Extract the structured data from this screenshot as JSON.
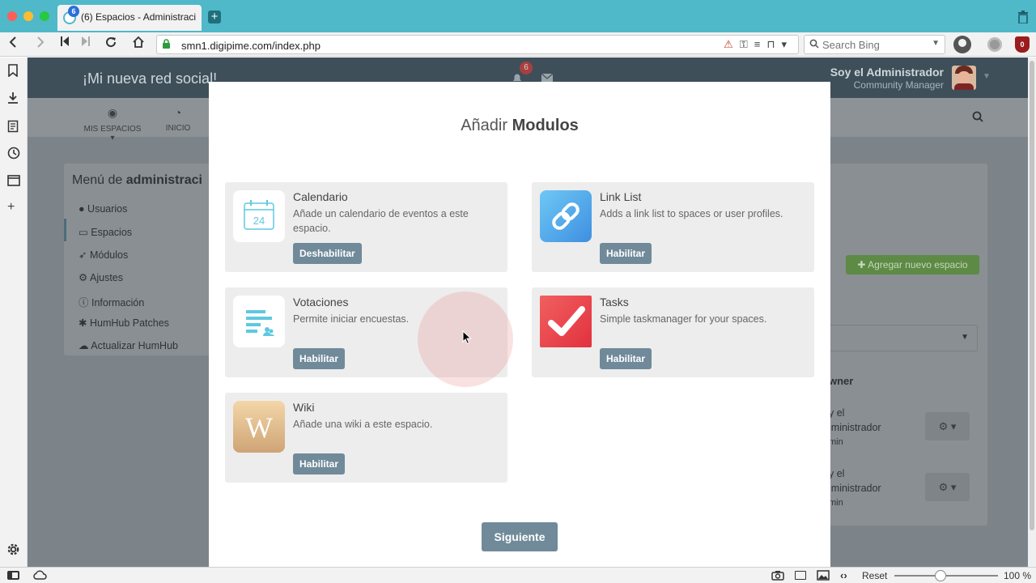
{
  "browser": {
    "tab_title": "(6) Espacios - Administraci",
    "tab_badge": "6",
    "url": "smn1.digipime.com/index.php",
    "search_placeholder": "Search Bing",
    "zoom_reset": "Reset",
    "zoom_level": "100 %",
    "zoom_fraction": 0.5
  },
  "site": {
    "network_name": "¡Mi nueva red social!",
    "notification_count": "6",
    "user_name": "Soy el Administrador",
    "user_role": "Community Manager"
  },
  "subnav": {
    "my_spaces": "MIS ESPACIOS",
    "home": "INICIO"
  },
  "admin_menu": {
    "title_prefix": "Menú de ",
    "title_bold": "administraci",
    "items": [
      {
        "label": "Usuarios",
        "icon": "user-icon"
      },
      {
        "label": "Espacios",
        "icon": "inbox-icon"
      },
      {
        "label": "Módulos",
        "icon": "rocket-icon"
      },
      {
        "label": "Ajustes",
        "icon": "cogs-icon"
      },
      {
        "label": "Información",
        "icon": "info-icon"
      },
      {
        "label": "HumHub Patches",
        "icon": "bug-icon"
      },
      {
        "label": "Actualizar HumHub",
        "icon": "cloud-download-icon"
      }
    ]
  },
  "right_panel": {
    "add_space": "Agregar nuevo espacio",
    "owner_header": "wner",
    "rows": [
      {
        "line1": "y el",
        "line2": "lministrador",
        "line3": "min"
      },
      {
        "line1": "y el",
        "line2": "lministrador",
        "line3": "min"
      }
    ]
  },
  "modal": {
    "title_prefix": "Añadir ",
    "title_bold": "Modulos",
    "modules": [
      {
        "name": "Calendario",
        "description": "Añade un calendario de eventos a este espacio.",
        "button": "Deshabilitar",
        "icon": "calendar-icon",
        "calendar_day": "24"
      },
      {
        "name": "Link List",
        "description": "Adds a link list to spaces or user profiles.",
        "button": "Habilitar",
        "icon": "link-icon"
      },
      {
        "name": "Votaciones",
        "description": "Permite iniciar encuestas.",
        "button": "Habilitar",
        "icon": "poll-icon"
      },
      {
        "name": "Tasks",
        "description": "Simple taskmanager for your spaces.",
        "button": "Habilitar",
        "icon": "checkmark-icon"
      },
      {
        "name": "Wiki",
        "description": "Añade una wiki a este espacio.",
        "button": "Habilitar",
        "icon": "wiki-icon",
        "wiki_letter": "W"
      }
    ],
    "next_button": "Siguiente"
  },
  "colors": {
    "browser_accent": "#4fb8c9",
    "button": "#708a9a",
    "add_space_button": "#5d8a45"
  }
}
